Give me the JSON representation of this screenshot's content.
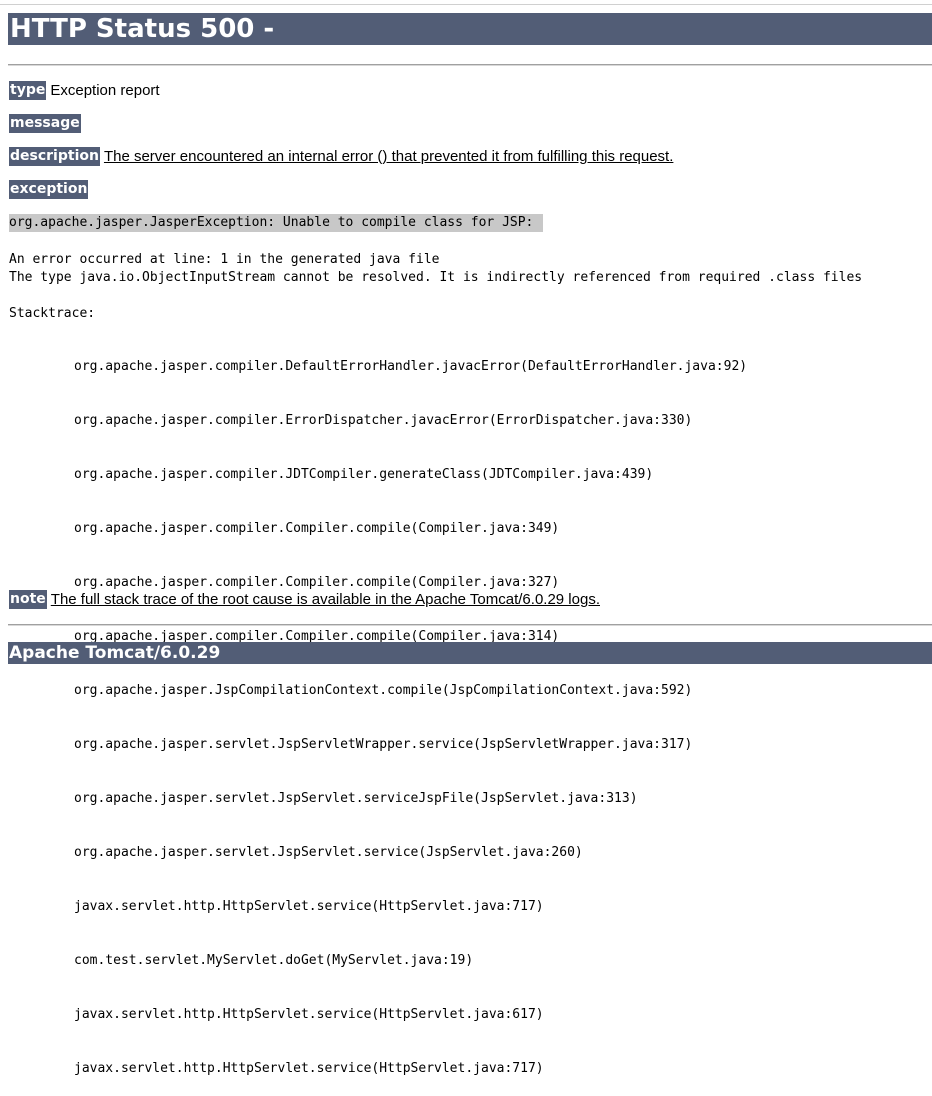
{
  "title": "HTTP Status 500 -",
  "type": {
    "label": "type",
    "value": "Exception report"
  },
  "message": {
    "label": "message",
    "value": ""
  },
  "description": {
    "label": "description",
    "value": "The server encountered an internal error () that prevented it from fulfilling this request."
  },
  "exception": {
    "label": "exception",
    "summary": "org.apache.jasper.JasperException: Unable to compile class for JSP:",
    "line1": "An error occurred at line: 1 in the generated java file",
    "line2": "The type java.io.ObjectInputStream cannot be resolved. It is indirectly referenced from required .class files",
    "stacktrace_label": "Stacktrace:",
    "stacktrace": [
      "org.apache.jasper.compiler.DefaultErrorHandler.javacError(DefaultErrorHandler.java:92)",
      "org.apache.jasper.compiler.ErrorDispatcher.javacError(ErrorDispatcher.java:330)",
      "org.apache.jasper.compiler.JDTCompiler.generateClass(JDTCompiler.java:439)",
      "org.apache.jasper.compiler.Compiler.compile(Compiler.java:349)",
      "org.apache.jasper.compiler.Compiler.compile(Compiler.java:327)",
      "org.apache.jasper.compiler.Compiler.compile(Compiler.java:314)",
      "org.apache.jasper.JspCompilationContext.compile(JspCompilationContext.java:592)",
      "org.apache.jasper.servlet.JspServletWrapper.service(JspServletWrapper.java:317)",
      "org.apache.jasper.servlet.JspServlet.serviceJspFile(JspServlet.java:313)",
      "org.apache.jasper.servlet.JspServlet.service(JspServlet.java:260)",
      "javax.servlet.http.HttpServlet.service(HttpServlet.java:717)",
      "com.test.servlet.MyServlet.doGet(MyServlet.java:19)",
      "javax.servlet.http.HttpServlet.service(HttpServlet.java:617)",
      "javax.servlet.http.HttpServlet.service(HttpServlet.java:717)"
    ]
  },
  "note": {
    "label": "note",
    "value": "The full stack trace of the root cause is available in the Apache Tomcat/6.0.29 logs."
  },
  "footer": "Apache Tomcat/6.0.29",
  "colors": {
    "header_bg": "#525d76",
    "header_text": "#ffffff",
    "exception_bg": "#c8c8c8"
  }
}
